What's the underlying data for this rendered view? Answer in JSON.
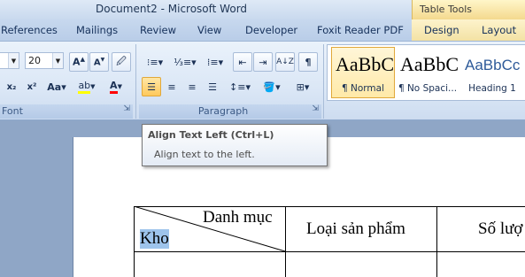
{
  "titlebar": {
    "title": "Document2 - Microsoft Word",
    "context_tab": "Table Tools"
  },
  "tabs": [
    "References",
    "Mailings",
    "Review",
    "View",
    "Developer",
    "Foxit Reader PDF",
    "Design",
    "Layout"
  ],
  "font_group": {
    "label": "Font",
    "font_size": "20"
  },
  "paragraph_group": {
    "label": "Paragraph"
  },
  "styles": [
    {
      "sample": "AaBbC",
      "name": "¶ Normal"
    },
    {
      "sample": "AaBbC",
      "name": "¶ No Spaci..."
    },
    {
      "sample": "AaBbCc",
      "name": "Heading 1"
    }
  ],
  "tooltip": {
    "title": "Align Text Left (Ctrl+L)",
    "description": "Align text to the left."
  },
  "table": {
    "header_diag_top": "Danh mục",
    "header_diag_bottom": "Kho",
    "col2": "Loại sản phẩm",
    "col3": "Số lượ"
  },
  "colors": {
    "highlight": "#ffff00",
    "font_color": "#ff0000",
    "active": "#ffc95c"
  }
}
